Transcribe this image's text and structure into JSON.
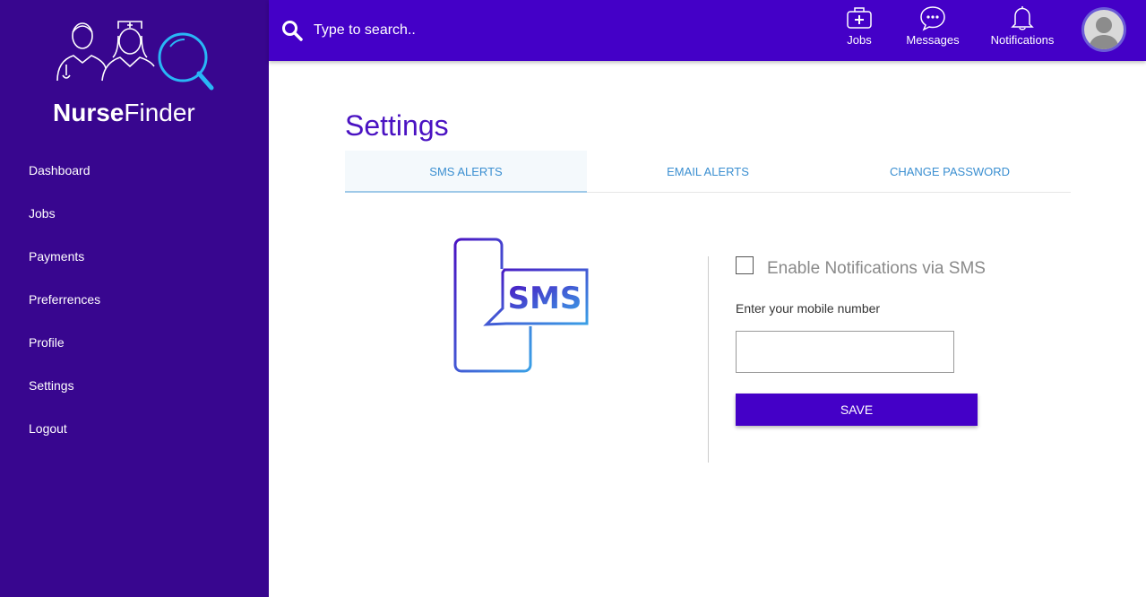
{
  "brand": {
    "name_bold": "Nurse",
    "name_light": "Finder"
  },
  "sidebar": {
    "items": [
      {
        "label": "Dashboard"
      },
      {
        "label": "Jobs"
      },
      {
        "label": "Payments"
      },
      {
        "label": "Preferrences"
      },
      {
        "label": "Profile"
      },
      {
        "label": "Settings"
      },
      {
        "label": "Logout"
      }
    ]
  },
  "topbar": {
    "search_placeholder": "Type to search..",
    "actions": [
      {
        "label": "Jobs",
        "icon": "medical-kit-icon"
      },
      {
        "label": "Messages",
        "icon": "chat-bubble-icon"
      },
      {
        "label": "Notifications",
        "icon": "bell-icon"
      }
    ]
  },
  "page": {
    "title": "Settings"
  },
  "tabs": [
    {
      "label": "SMS ALERTS",
      "active": true
    },
    {
      "label": "EMAIL ALERTS",
      "active": false
    },
    {
      "label": "CHANGE PASSWORD",
      "active": false
    }
  ],
  "sms_panel": {
    "illustration_text": "SMS",
    "checkbox_label": "Enable Notifications via SMS",
    "checkbox_checked": false,
    "mobile_label": "Enter your mobile number",
    "mobile_value": "",
    "save_label": "SAVE"
  },
  "colors": {
    "sidebar_bg": "#38068f",
    "topbar_bg": "#4400c7",
    "title": "#4a12c2",
    "tab_text": "#3b8fd1",
    "accent_cyan": "#29b6f6"
  }
}
